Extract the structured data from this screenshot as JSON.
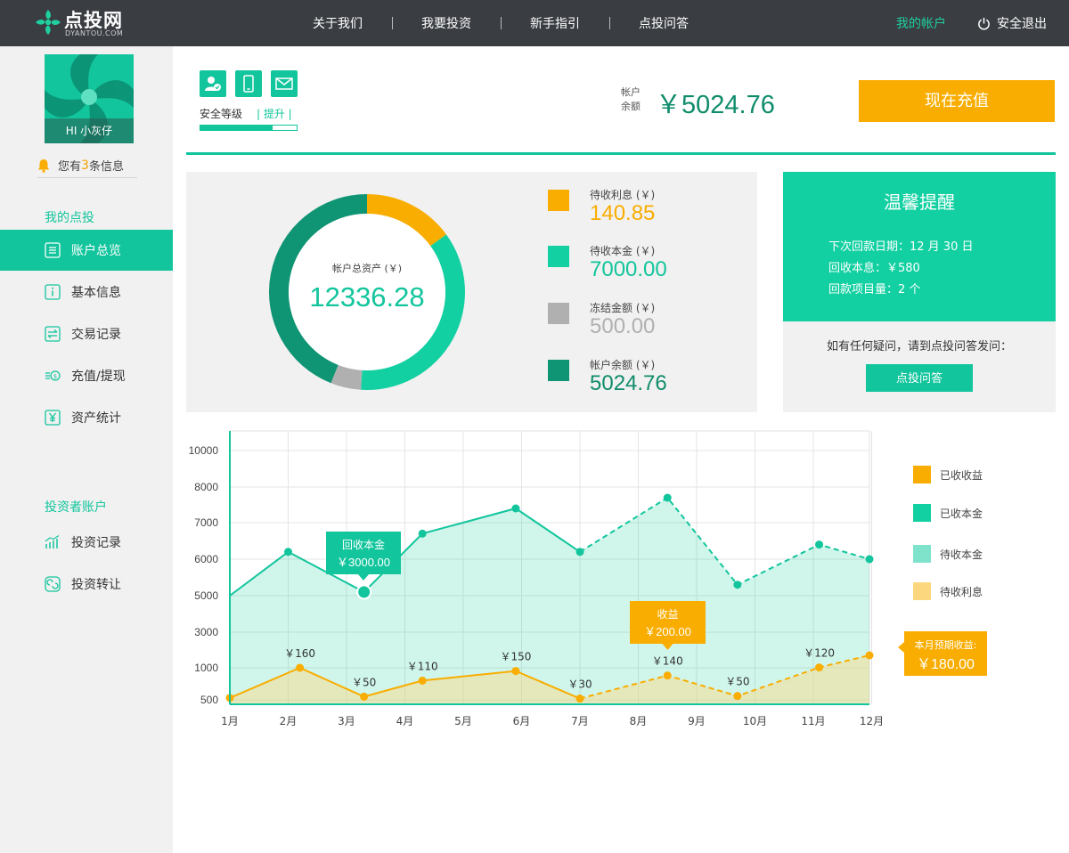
{
  "brand": {
    "name": "点投网",
    "sub": "DYANTOU.COM"
  },
  "nav": {
    "items": [
      "关于我们",
      "我要投资",
      "新手指引",
      "点投问答"
    ],
    "account": "我的帐户",
    "logout": "安全退出"
  },
  "user": {
    "greeting": "HI 小灰仔",
    "msg_prefix": "您有",
    "msg_count": "3",
    "msg_suffix": "条信息"
  },
  "sidebar": {
    "section1": "我的点投",
    "items1": [
      "账户总览",
      "基本信息",
      "交易记录",
      "充值/提现",
      "资产统计"
    ],
    "section2": "投资者账户",
    "items2": [
      "投资记录",
      "投资转让"
    ]
  },
  "security": {
    "label": "安全等级",
    "upgrade": "| 提升 |",
    "level": 0.75
  },
  "balance": {
    "label": "帐户余额",
    "value": "￥5024.76",
    "charge_btn": "现在充值"
  },
  "assets": {
    "total_label": "帐户总资产 (￥)",
    "total_value": "12336.28",
    "items": [
      {
        "label": "待收利息 (￥)",
        "value": "140.85",
        "color": "#f9ad00"
      },
      {
        "label": "待收本金 (￥)",
        "value": "7000.00",
        "color": "#12d0a1"
      },
      {
        "label": "冻结金额 (￥)",
        "value": "500.00",
        "color": "#b0b0b0"
      },
      {
        "label": "帐户余额 (￥)",
        "value": "5024.76",
        "color": "#0f9474"
      }
    ],
    "donut_fractions": [
      0.15,
      0.36,
      0.05,
      0.44
    ]
  },
  "reminder": {
    "title": "温馨提醒",
    "lines": [
      "下次回款日期：12 月 30 日",
      "回收本息：￥580",
      "回款项目量：2 个"
    ],
    "ask_text": "如有任何疑问，请到点投问答发问：",
    "ask_btn": "点投问答"
  },
  "colors": {
    "accent": "#12c59c",
    "orange": "#f9ad00",
    "dark": "#0f8c6b"
  },
  "chart_data": {
    "type": "line",
    "categories": [
      "1月",
      "2月",
      "3月",
      "4月",
      "5月",
      "6月",
      "7月",
      "8月",
      "9月",
      "10月",
      "11月",
      "12月"
    ],
    "y_ticks": [
      "10000",
      "8000",
      "7000",
      "6000",
      "5000",
      "3000",
      "1000",
      "500"
    ],
    "principal": {
      "points": [
        [
          1.0,
          5000
        ],
        [
          2.0,
          6200
        ],
        [
          3.3,
          5100
        ],
        [
          4.3,
          6700
        ],
        [
          5.9,
          7400
        ],
        [
          7.0,
          6200
        ],
        [
          8.5,
          7700
        ],
        [
          9.7,
          5300
        ],
        [
          11.1,
          6400
        ],
        [
          12.2,
          6000
        ]
      ],
      "solid_until": 6
    },
    "income": {
      "points": [
        [
          1.0,
          530
        ],
        [
          2.2,
          1000
        ],
        [
          3.3,
          550
        ],
        [
          4.3,
          800
        ],
        [
          5.9,
          950
        ],
        [
          7.0,
          520
        ],
        [
          8.5,
          880
        ],
        [
          9.7,
          560
        ],
        [
          11.1,
          1020
        ],
        [
          12.2,
          1700
        ]
      ],
      "labels": [
        "",
        "￥160",
        "￥50",
        "￥110",
        "￥150",
        "￥30",
        "￥140",
        "￥50",
        "￥120",
        ""
      ],
      "solid_until": 6
    },
    "tooltips": [
      {
        "title": "回收本金",
        "value": "￥3000.00"
      },
      {
        "title": "收益",
        "value": "￥200.00"
      },
      {
        "title": "本月预期收益:",
        "value": "￥180.00"
      }
    ],
    "legend": [
      {
        "name": "已收收益",
        "color": "#f9ad00"
      },
      {
        "name": "已收本金",
        "color": "#12d0a1"
      },
      {
        "name": "待收本金",
        "color": "#7fe3cb"
      },
      {
        "name": "待收利息",
        "color": "#fdd77e"
      }
    ]
  }
}
